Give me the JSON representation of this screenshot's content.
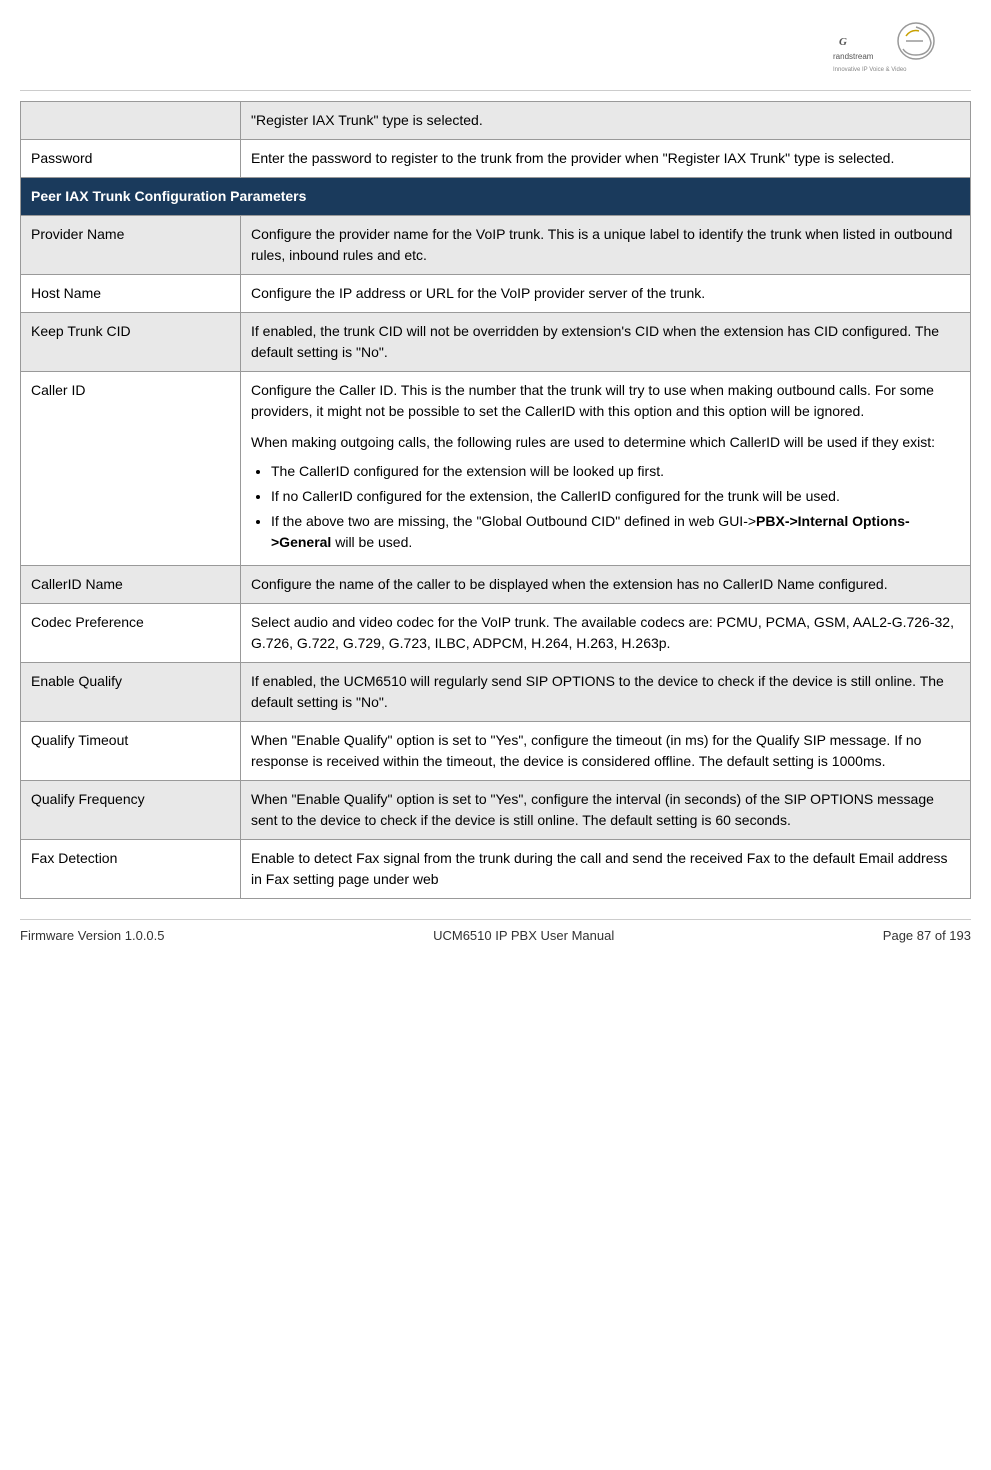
{
  "logo": {
    "text": "Grandstream",
    "subtitle": "Innovative IP Voice & Video"
  },
  "rows": [
    {
      "id": "register-iax-shaded",
      "label": "",
      "description": "\"Register IAX Trunk\" type is selected.",
      "shaded": true
    },
    {
      "id": "password",
      "label": "Password",
      "description": "Enter the password to register to the trunk from the provider when \"Register IAX Trunk\" type is selected.",
      "shaded": false
    },
    {
      "id": "peer-iax-header",
      "label": "Peer IAX Trunk Configuration Parameters",
      "description": null,
      "isHeader": true
    },
    {
      "id": "provider-name",
      "label": "Provider Name",
      "description": "Configure the provider name for the VoIP trunk. This is a unique label to identify the trunk when listed in outbound rules, inbound rules and etc.",
      "shaded": true
    },
    {
      "id": "host-name",
      "label": "Host Name",
      "description": "Configure the IP address or URL for the VoIP provider server of the trunk.",
      "shaded": false
    },
    {
      "id": "keep-trunk-cid",
      "label": "Keep Trunk CID",
      "description": "If enabled, the trunk CID will not be overridden by extension's CID when the extension has CID configured. The default setting is \"No\".",
      "shaded": true
    },
    {
      "id": "caller-id",
      "label": "Caller ID",
      "description_parts": [
        "Configure the Caller ID. This is the number that the trunk will try to use when making outbound calls. For some providers, it might not be possible to set the CallerID with this option and this option will be ignored.",
        "When making outgoing calls, the following rules are used to determine which CallerID will be used if they exist:"
      ],
      "bullets": [
        "The CallerID configured for the extension will be looked up first.",
        "If no CallerID configured for the extension, the CallerID configured for the trunk will be used.",
        "If the above two are missing, the \"Global Outbound CID\" defined in web GUI->PBX->Internal Options->General will be used."
      ],
      "bullet_bold_part": "PBX->Internal Options->General",
      "shaded": false
    },
    {
      "id": "callerid-name",
      "label": "CallerID Name",
      "description": "Configure the name of the caller to be displayed when the extension has no CallerID Name configured.",
      "shaded": true
    },
    {
      "id": "codec-preference",
      "label": "Codec Preference",
      "description": "Select audio and video codec for the VoIP trunk. The available codecs are: PCMU, PCMA, GSM, AAL2-G.726-32, G.726, G.722, G.729, G.723, ILBC, ADPCM, H.264, H.263, H.263p.",
      "shaded": false
    },
    {
      "id": "enable-qualify",
      "label": "Enable Qualify",
      "description": "If enabled, the UCM6510 will regularly send SIP OPTIONS to the device to check if the device is still online. The default setting is \"No\".",
      "shaded": true
    },
    {
      "id": "qualify-timeout",
      "label": "Qualify Timeout",
      "description": "When \"Enable Qualify\" option is set to \"Yes\", configure the timeout (in ms) for the Qualify SIP message. If no response is received within the timeout, the device is considered offline. The default setting is 1000ms.",
      "shaded": false
    },
    {
      "id": "qualify-frequency",
      "label": "Qualify Frequency",
      "description": "When \"Enable Qualify\" option is set to \"Yes\", configure the interval (in seconds) of the SIP OPTIONS message sent to the device to check if the device is still online. The default setting is 60 seconds.",
      "shaded": true
    },
    {
      "id": "fax-detection",
      "label": "Fax Detection",
      "description": "Enable to detect Fax signal from the trunk during the call and send the received Fax to the default Email address in Fax setting page under web",
      "shaded": false
    }
  ],
  "footer": {
    "firmware": "Firmware Version 1.0.0.5",
    "center": "UCM6510 IP PBX User Manual",
    "page": "Page 87 of 193"
  }
}
